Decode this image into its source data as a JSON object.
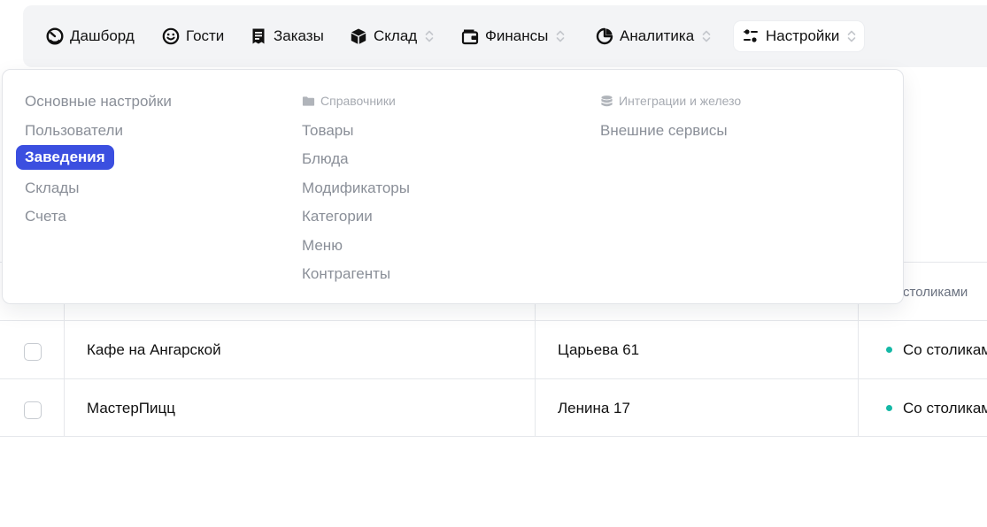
{
  "nav": {
    "items": [
      {
        "label": "Дашборд",
        "icon": "gauge-icon",
        "has_chevron": false
      },
      {
        "label": "Гости",
        "icon": "smiley-icon",
        "has_chevron": false
      },
      {
        "label": "Заказы",
        "icon": "receipt-icon",
        "has_chevron": false
      },
      {
        "label": "Склад",
        "icon": "box-icon",
        "has_chevron": true
      },
      {
        "label": "Финансы",
        "icon": "wallet-icon",
        "has_chevron": true
      },
      {
        "label": "Аналитика",
        "icon": "chart-pie-icon",
        "has_chevron": true
      },
      {
        "label": "Настройки",
        "icon": "sliders-icon",
        "has_chevron": true,
        "active": true
      }
    ]
  },
  "dropdown": {
    "col1": {
      "items": [
        "Основные настройки",
        "Пользователи",
        "Заведения",
        "Склады",
        "Счета"
      ],
      "selected": "Заведения"
    },
    "col2": {
      "heading": "Справочники",
      "heading_icon": "folder-icon",
      "items": [
        "Товары",
        "Блюда",
        "Модификаторы",
        "Категории",
        "Меню",
        "Контрагенты"
      ]
    },
    "col3": {
      "heading": "Интеграции и железо",
      "heading_icon": "database-icon",
      "items": [
        "Внешние сервисы"
      ]
    }
  },
  "table": {
    "header_partial": "столиками",
    "rows": [
      {
        "name": "Кафе на Ангарской",
        "address": "Царьева 61",
        "type": "Со столиками"
      },
      {
        "name": "МастерПицц",
        "address": "Ленина 17",
        "type": "Со столиками"
      }
    ]
  },
  "colors": {
    "accent": "#3b4fe0",
    "status_dot": "#14b8a6",
    "nav_bg": "#f3f4f6",
    "muted_text": "#8a8f98"
  }
}
